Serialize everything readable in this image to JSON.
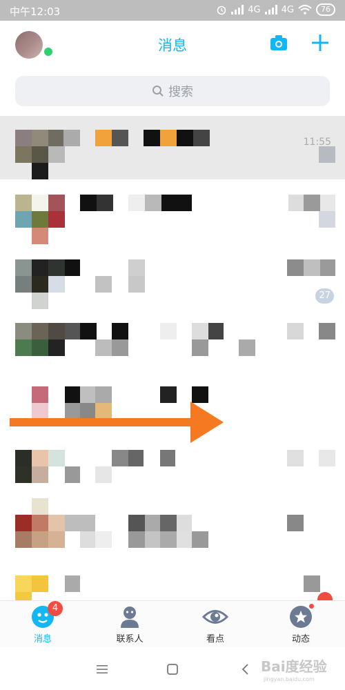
{
  "status_bar": {
    "time": "中午12:03",
    "signal_1": "4G",
    "signal_2": "4G",
    "battery": "76",
    "icons": [
      "alarm-icon",
      "signal-icon",
      "hd-signal-icon",
      "wifi-icon",
      "battery-icon"
    ]
  },
  "header": {
    "title": "消息",
    "icons": [
      "camera-icon",
      "plus-icon"
    ],
    "accent": "#12b7f5",
    "online_color": "#2ed071"
  },
  "search": {
    "placeholder": "搜索",
    "icon": "search-icon"
  },
  "conversations": [
    {
      "time": "11:55",
      "pinned": true
    },
    {
      "time": "",
      "pinned": false
    },
    {
      "time": "",
      "unread": "27",
      "pinned": false
    },
    {
      "time": "",
      "pinned": false
    },
    {
      "time": "",
      "pinned": false
    },
    {
      "time": "",
      "pinned": false
    },
    {
      "time": "",
      "pinned": false
    },
    {
      "time": "",
      "pinned": false
    }
  ],
  "tabs": [
    {
      "label": "消息",
      "icon": "chat-face-icon",
      "badge": "4",
      "active": true
    },
    {
      "label": "联系人",
      "icon": "contact-person-icon",
      "active": false
    },
    {
      "label": "看点",
      "icon": "eye-icon",
      "active": false
    },
    {
      "label": "动态",
      "icon": "star-icon",
      "dot": true,
      "active": false
    }
  ],
  "nav": {
    "icons": [
      "menu-icon",
      "home-square-icon",
      "back-icon"
    ]
  },
  "watermark": {
    "text": "Bai度经验",
    "subtext": "jingyan.baidu.com"
  },
  "colors": {
    "badge_red": "#f24c42",
    "arrow_orange": "#f47920",
    "pinned_bg": "#e9e9e9"
  }
}
